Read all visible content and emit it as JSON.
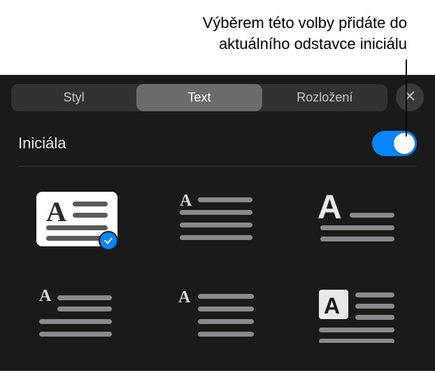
{
  "callout": {
    "line1": "Výběrem této volby přidáte do",
    "line2": "aktuálního odstavce iniciálu"
  },
  "tabs": {
    "items": [
      {
        "label": "Styl"
      },
      {
        "label": "Text"
      },
      {
        "label": "Rozložení"
      }
    ],
    "activeIndex": 1
  },
  "dropcap": {
    "label": "Iniciála",
    "enabled": true,
    "selectedStyle": 0,
    "styles": [
      {
        "id": "drop-2line-dark"
      },
      {
        "id": "drop-2line-small"
      },
      {
        "id": "raised-bold"
      },
      {
        "id": "inline-small"
      },
      {
        "id": "margin-small"
      },
      {
        "id": "boxed-inverse"
      }
    ]
  }
}
